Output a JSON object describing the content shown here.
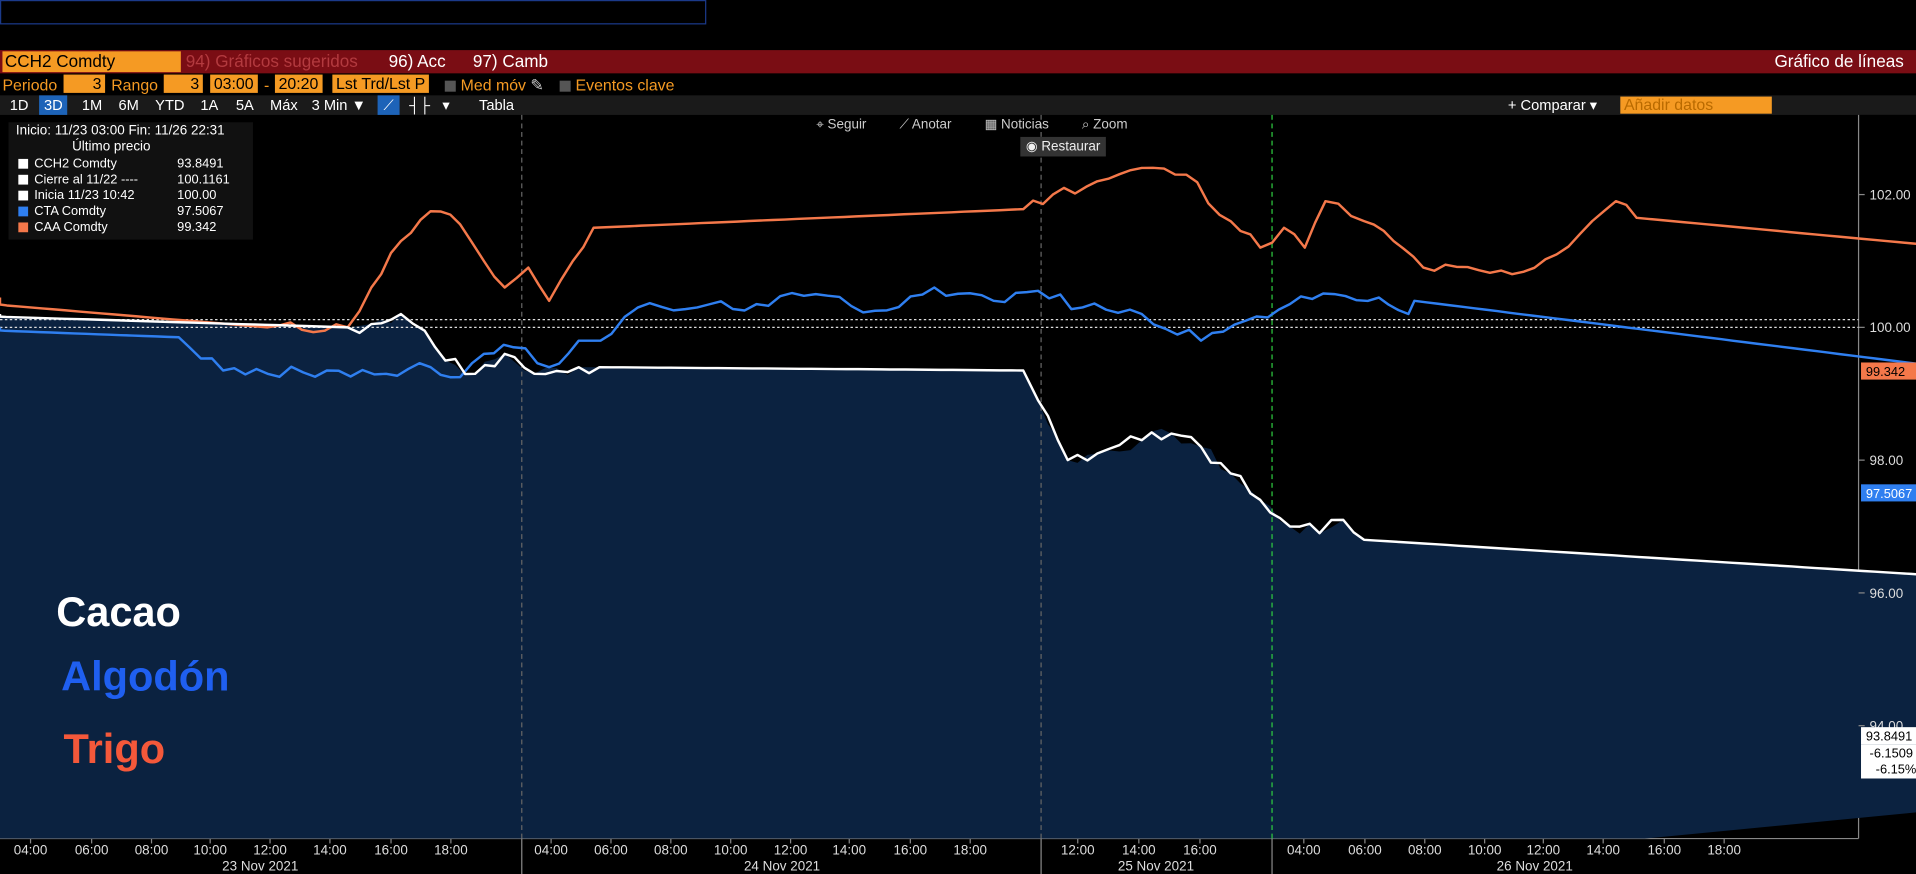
{
  "header": {
    "ticker": "CCH2 Comdty",
    "suggested": "94) Gráficos sugeridos",
    "acc": "96) Acc",
    "camb": "97) Camb",
    "chart_type": "Gráfico de líneas"
  },
  "settings": {
    "periodo_label": "Periodo",
    "periodo_val": "3",
    "rango_label": "Rango",
    "rango_val": "3",
    "time_from": "03:00",
    "dash": "-",
    "time_to": "20:20",
    "lst": "Lst Trd/Lst P",
    "med": "Med móv",
    "eventos": "Eventos clave"
  },
  "range_tabs": [
    "1D",
    "3D",
    "1M",
    "6M",
    "YTD",
    "1A",
    "5A",
    "Máx",
    "3 Min ▼"
  ],
  "toolbar": {
    "tabla": "Tabla",
    "comparar": "+ Comparar ▾",
    "add_placeholder": "Añadir datos"
  },
  "chart_tools": {
    "seguir": "Seguir",
    "anotar": "Anotar",
    "noticias": "Noticias",
    "zoom": "Zoom",
    "restaurar": "Restaurar"
  },
  "legend": {
    "header": "Inicio: 11/23 03:00 Fin: 11/26 22:31",
    "sub": "Último precio",
    "rows": [
      {
        "name": "CCH2 Comdty",
        "value": "93.8491",
        "color": "#ffffff"
      },
      {
        "name": "Cierre al 11/22 ----",
        "value": "100.1161",
        "color": "#ffffff"
      },
      {
        "name": "Inicia 11/23 10:42",
        "value": "100.00",
        "color": "#ffffff"
      },
      {
        "name": "CTA Comdty",
        "value": "97.5067",
        "color": "#2f7ff0"
      },
      {
        "name": "CAA Comdty",
        "value": "99.342",
        "color": "#f4784a"
      }
    ]
  },
  "labels": {
    "cacao": "Cacao",
    "algodon": "Algodón",
    "trigo": "Trigo"
  },
  "value_tags": {
    "trigo": "99.342",
    "algodon": "97.5067",
    "cacao": "93.8491",
    "chg": "-6.1509",
    "pct": "-6.15%"
  },
  "chart_data": {
    "type": "line",
    "title": "",
    "ylim": [
      92.3,
      103.2
    ],
    "y_ticks": [
      "102.00",
      "100.00",
      "98.00",
      "96.00",
      "94.00"
    ],
    "x_ticks": [
      "04:00",
      "06:00",
      "08:00",
      "10:00",
      "12:00",
      "14:00",
      "16:00",
      "18:00",
      "04:00",
      "06:00",
      "08:00",
      "10:00",
      "12:00",
      "14:00",
      "16:00",
      "18:00",
      "12:00",
      "14:00",
      "16:00",
      "04:00",
      "06:00",
      "08:00",
      "10:00",
      "12:00",
      "14:00",
      "16:00",
      "18:00"
    ],
    "days": [
      "23 Nov 2021",
      "24 Nov 2021",
      "25 Nov 2021",
      "26 Nov 2021"
    ],
    "reference_lines": [
      100.1161,
      100.0
    ],
    "series": [
      {
        "name": "CAA Comdty",
        "color": "#f4784a",
        "points": [
          [
            -4,
            100.45
          ],
          [
            8,
            100.0
          ],
          [
            10.7,
            100.0
          ],
          [
            11.5,
            100.6
          ],
          [
            12.5,
            101.3
          ],
          [
            13.5,
            101.75
          ],
          [
            14.5,
            101.55
          ],
          [
            15.3,
            101.0
          ],
          [
            16,
            100.6
          ],
          [
            16.8,
            100.9
          ],
          [
            17.5,
            100.4
          ],
          [
            18.3,
            101.0
          ],
          [
            19,
            101.5
          ],
          [
            33.5,
            101.78
          ],
          [
            34.5,
            102.0
          ],
          [
            36,
            102.2
          ],
          [
            37.5,
            102.4
          ],
          [
            39,
            102.3
          ],
          [
            40.5,
            101.6
          ],
          [
            41.5,
            101.2
          ],
          [
            42.3,
            101.5
          ],
          [
            43,
            101.2
          ],
          [
            43.7,
            101.9
          ],
          [
            45,
            101.6
          ],
          [
            46,
            101.3
          ],
          [
            47,
            100.9
          ],
          [
            50,
            100.8
          ],
          [
            51.5,
            101.1
          ],
          [
            52.7,
            101.6
          ],
          [
            53.5,
            101.9
          ],
          [
            54.2,
            101.65
          ],
          [
            79.5,
            100.6
          ],
          [
            80.5,
            99.8
          ],
          [
            81.3,
            99.3
          ],
          [
            82.5,
            99.0
          ],
          [
            83.5,
            98.9
          ],
          [
            84.5,
            99.2
          ],
          [
            85,
            99.342
          ]
        ]
      },
      {
        "name": "CTA Comdty",
        "color": "#2f7ff0",
        "points": [
          [
            -4,
            100.0
          ],
          [
            5,
            99.85
          ],
          [
            6.5,
            99.35
          ],
          [
            8,
            99.3
          ],
          [
            10,
            99.35
          ],
          [
            12,
            99.3
          ],
          [
            13.5,
            99.4
          ],
          [
            14.5,
            99.25
          ],
          [
            15.3,
            99.6
          ],
          [
            16.3,
            99.7
          ],
          [
            17.5,
            99.4
          ],
          [
            18.5,
            99.8
          ],
          [
            19.6,
            99.9
          ],
          [
            20.5,
            100.3
          ],
          [
            22.5,
            100.3
          ],
          [
            24.5,
            100.35
          ],
          [
            26.5,
            100.5
          ],
          [
            28.5,
            100.25
          ],
          [
            30.5,
            100.6
          ],
          [
            32.5,
            100.4
          ],
          [
            34,
            100.55
          ],
          [
            35.5,
            100.3
          ],
          [
            37.5,
            100.2
          ],
          [
            39.5,
            99.8
          ],
          [
            41,
            100.1
          ],
          [
            42.5,
            100.35
          ],
          [
            44,
            100.5
          ],
          [
            45.5,
            100.45
          ],
          [
            46.5,
            100.2
          ],
          [
            46.7,
            100.4
          ],
          [
            79.8,
            98.55
          ],
          [
            80,
            97.1
          ],
          [
            80.5,
            97.4
          ],
          [
            81,
            97.2
          ],
          [
            81.5,
            97.4
          ],
          [
            82,
            97.25
          ],
          [
            82.5,
            97.55
          ],
          [
            83,
            97.5067
          ]
        ]
      },
      {
        "name": "CCH2 Comdty",
        "color": "#ffffff",
        "points": [
          [
            -4,
            100.2
          ],
          [
            10.7,
            100.0
          ],
          [
            11.5,
            100.05
          ],
          [
            12.5,
            100.2
          ],
          [
            13.3,
            99.95
          ],
          [
            14,
            99.5
          ],
          [
            15,
            99.3
          ],
          [
            16,
            99.6
          ],
          [
            17,
            99.3
          ],
          [
            18.5,
            99.4
          ],
          [
            19.2,
            99.4
          ],
          [
            33.5,
            99.35
          ],
          [
            34,
            98.9
          ],
          [
            35,
            98.0
          ],
          [
            36,
            98.1
          ],
          [
            37.5,
            98.3
          ],
          [
            38.5,
            98.4
          ],
          [
            39.5,
            98.2
          ],
          [
            40.5,
            97.8
          ],
          [
            41.5,
            97.4
          ],
          [
            42.5,
            97.0
          ],
          [
            43.5,
            96.9
          ],
          [
            44.3,
            97.1
          ],
          [
            45,
            96.8
          ],
          [
            79.1,
            95.85
          ],
          [
            79.5,
            95.6
          ],
          [
            80,
            95.1
          ],
          [
            80.5,
            95.2
          ],
          [
            81,
            94.95
          ],
          [
            81.6,
            94.6
          ],
          [
            82.5,
            94.25
          ],
          [
            83,
            93.8491
          ],
          [
            90.5,
            93.8491
          ]
        ]
      }
    ]
  }
}
